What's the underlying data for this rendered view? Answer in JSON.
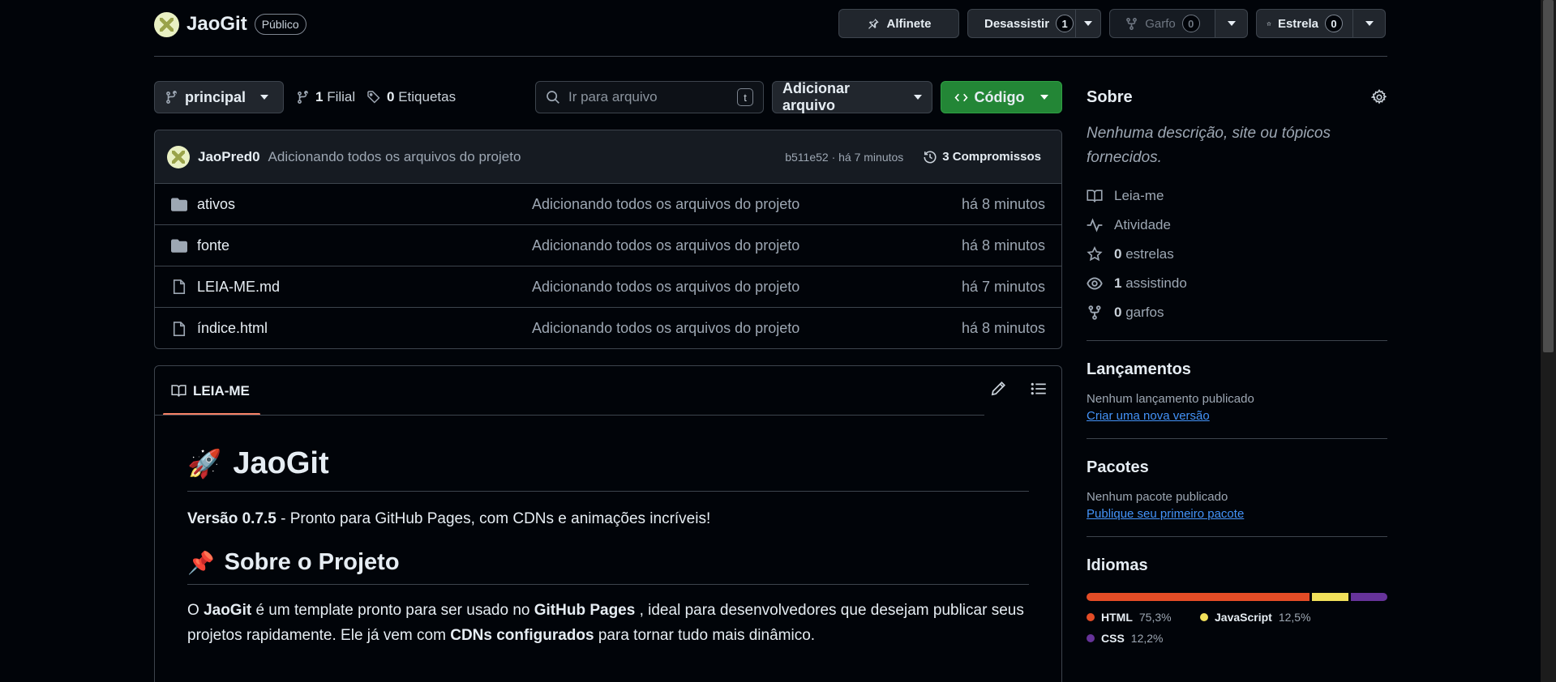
{
  "repo": {
    "name": "JaoGit",
    "visibility": "Público"
  },
  "header_actions": {
    "pin_label": "Alfinete",
    "watch_label": "Desassistir",
    "watch_count": "1",
    "fork_label": "Garfo",
    "fork_count": "0",
    "star_label": "Estrela",
    "star_count": "0"
  },
  "toolbar": {
    "branch": "principal",
    "branches_count": "1",
    "branches_label": "Filial",
    "tags_count": "0",
    "tags_label": "Etiquetas",
    "search_placeholder": "Ir para arquivo",
    "search_shortcut": "t",
    "add_file_label": "Adicionar arquivo",
    "code_label": "Código"
  },
  "commit": {
    "author": "JaoPred0",
    "message": "Adicionando todos os arquivos do projeto",
    "hash_time": "b511e52 · há 7 minutos",
    "commits_label": "3 Compromissos"
  },
  "files": [
    {
      "type": "folder",
      "name": "ativos",
      "message": "Adicionando todos os arquivos do projeto",
      "time": "há 8 minutos"
    },
    {
      "type": "folder",
      "name": "fonte",
      "message": "Adicionando todos os arquivos do projeto",
      "time": "há 8 minutos"
    },
    {
      "type": "file",
      "name": "LEIA-ME.md",
      "message": "Adicionando todos os arquivos do projeto",
      "time": "há 7 minutos"
    },
    {
      "type": "file",
      "name": "índice.html",
      "message": "Adicionando todos os arquivos do projeto",
      "time": "há 8 minutos"
    }
  ],
  "readme": {
    "tab_label": "LEIA-ME",
    "h1_emoji": "🚀",
    "h1_text": "JaoGit",
    "p1_bold": "Versão 0.7.5",
    "p1_rest": " - Pronto para GitHub Pages, com CDNs e animações incríveis!",
    "h2_emoji": "📌",
    "h2_text": "Sobre o Projeto",
    "p2_a": "O ",
    "p2_b1": "JaoGit",
    "p2_c": " é um template pronto para ser usado no ",
    "p2_b2": "GitHub Pages",
    "p2_d": " , ideal para desenvolvedores que desejam publicar seus projetos rapidamente. Ele já vem com ",
    "p2_b3": "CDNs configurados",
    "p2_e": " para tornar tudo mais dinâmico."
  },
  "sidebar": {
    "about_title": "Sobre",
    "about_desc": "Nenhuma descrição, site ou tópicos fornecidos.",
    "readme_link": "Leia-me",
    "activity_link": "Atividade",
    "stars_count": "0",
    "stars_label": "estrelas",
    "watching_count": "1",
    "watching_label": "assistindo",
    "forks_count": "0",
    "forks_label": "garfos",
    "releases_title": "Lançamentos",
    "releases_text": "Nenhum lançamento publicado",
    "releases_link": "Criar uma nova versão",
    "packages_title": "Pacotes",
    "packages_text": "Nenhum pacote publicado",
    "packages_link": "Publique seu primeiro pacote",
    "languages_title": "Idiomas",
    "languages": [
      {
        "name": "HTML",
        "percent": "75,3%",
        "value": 75.3,
        "color": "#e34c26"
      },
      {
        "name": "JavaScript",
        "percent": "12,5%",
        "value": 12.5,
        "color": "#f1e05a"
      },
      {
        "name": "CSS",
        "percent": "12,2%",
        "value": 12.2,
        "color": "#663399"
      }
    ]
  }
}
